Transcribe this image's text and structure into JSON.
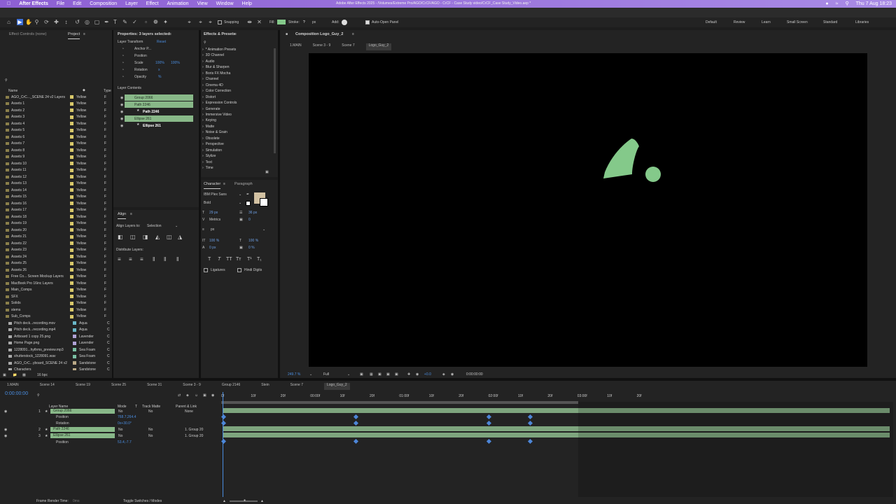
{
  "menubar": {
    "app": "After Effects",
    "items": [
      "File",
      "Edit",
      "Composition",
      "Layer",
      "Effect",
      "Animation",
      "View",
      "Window",
      "Help"
    ],
    "title": "Adobe After Effects 2025 - /Volumes/Extreme Pro/AGO/CrCF/AGO - CrCF - Case Study video/CrCF_Case Study_Video.aep *",
    "clock": "Thu 7 Aug 18:23"
  },
  "toolbar": {
    "snapping": "Snapping",
    "fill": "Fill:",
    "stroke": "Stroke:",
    "stroke_unit": "px",
    "add": "Add:",
    "auto_open": "Auto-Open Panel",
    "workspaces": [
      "Default",
      "Review",
      "Learn",
      "Small Screen",
      "Standard",
      "Libraries"
    ]
  },
  "project": {
    "tabs": [
      "Effect Controls (none)",
      "Project"
    ],
    "col_name": "Name",
    "col_type": "Type",
    "bpc": "16 bpc",
    "items": [
      {
        "name": "AGO_CrC..._SCENE 24 v2 Layers",
        "label": "Yellow",
        "kind": "F"
      },
      {
        "name": "Assets 1",
        "label": "Yellow",
        "kind": "F"
      },
      {
        "name": "Assets 2",
        "label": "Yellow",
        "kind": "F"
      },
      {
        "name": "Assets 3",
        "label": "Yellow",
        "kind": "F"
      },
      {
        "name": "Assets 4",
        "label": "Yellow",
        "kind": "F"
      },
      {
        "name": "Assets 5",
        "label": "Yellow",
        "kind": "F"
      },
      {
        "name": "Assets 6",
        "label": "Yellow",
        "kind": "F"
      },
      {
        "name": "Assets 7",
        "label": "Yellow",
        "kind": "F"
      },
      {
        "name": "Assets 8",
        "label": "Yellow",
        "kind": "F"
      },
      {
        "name": "Assets 9",
        "label": "Yellow",
        "kind": "F"
      },
      {
        "name": "Assets 10",
        "label": "Yellow",
        "kind": "F"
      },
      {
        "name": "Assets 11",
        "label": "Yellow",
        "kind": "F"
      },
      {
        "name": "Assets 12",
        "label": "Yellow",
        "kind": "F"
      },
      {
        "name": "Assets 13",
        "label": "Yellow",
        "kind": "F"
      },
      {
        "name": "Assets 14",
        "label": "Yellow",
        "kind": "F"
      },
      {
        "name": "Assets 15",
        "label": "Yellow",
        "kind": "F"
      },
      {
        "name": "Assets 16",
        "label": "Yellow",
        "kind": "F"
      },
      {
        "name": "Assets 17",
        "label": "Yellow",
        "kind": "F"
      },
      {
        "name": "Assets 18",
        "label": "Yellow",
        "kind": "F"
      },
      {
        "name": "Assets 19",
        "label": "Yellow",
        "kind": "F"
      },
      {
        "name": "Assets 20",
        "label": "Yellow",
        "kind": "F"
      },
      {
        "name": "Assets 21",
        "label": "Yellow",
        "kind": "F"
      },
      {
        "name": "Assets 22",
        "label": "Yellow",
        "kind": "F"
      },
      {
        "name": "Assets 23",
        "label": "Yellow",
        "kind": "F"
      },
      {
        "name": "Assets 24",
        "label": "Yellow",
        "kind": "F"
      },
      {
        "name": "Assets 25",
        "label": "Yellow",
        "kind": "F"
      },
      {
        "name": "Assets 26",
        "label": "Yellow",
        "kind": "F"
      },
      {
        "name": "Free Co... Screen Mockup Layers",
        "label": "Yellow",
        "kind": "F"
      },
      {
        "name": "MacBook Pro 16inc Layers",
        "label": "Yellow",
        "kind": "F"
      },
      {
        "name": "Main_Comps",
        "label": "Yellow",
        "kind": "F"
      },
      {
        "name": "SFX",
        "label": "Yellow",
        "kind": "F"
      },
      {
        "name": "Solids",
        "label": "Yellow",
        "kind": "F"
      },
      {
        "name": "stems",
        "label": "Yellow",
        "kind": "F"
      },
      {
        "name": "Sub_Comps",
        "label": "Yellow",
        "kind": "F"
      },
      {
        "name": "Pitch deck...recording.mov",
        "label": "Aqua",
        "kind": "C"
      },
      {
        "name": "Pitch deck...recording.mp4",
        "label": "Aqua",
        "kind": "C"
      },
      {
        "name": "Artboard 1 copy 25.png",
        "label": "Lavender",
        "kind": "C"
      },
      {
        "name": "Home Page.png",
        "label": "Lavender",
        "kind": "C"
      },
      {
        "name": "1228091...hythms_preview.mp3",
        "label": "Sea Foam",
        "kind": "C"
      },
      {
        "name": "shutterstock_1228091.wav",
        "label": "Sea Foam",
        "kind": "C"
      },
      {
        "name": "AGO_CrC...yboard_SCENE 24 v2",
        "label": "Sandstone",
        "kind": "C"
      },
      {
        "name": "Characters",
        "label": "Sandstone",
        "kind": "C"
      }
    ]
  },
  "properties": {
    "title": "Properties: 3 layers selected",
    "transform_title": "Layer Transform",
    "reset": "Reset",
    "fields": [
      "Anchor P...",
      "Position",
      "Scale",
      "Rotation",
      "Opacity"
    ],
    "scale_x": "100%",
    "scale_y": "100%",
    "rotation": "x",
    "opacity": "%",
    "contents_title": "Layer Contents",
    "contents": [
      "Group 2066",
      "Path 2246",
      "Path 2246",
      "Ellipse 261",
      "Ellipse 261"
    ]
  },
  "align": {
    "title": "Align",
    "align_to_label": "Align Layers to:",
    "align_to_value": "Selection",
    "distribute_label": "Distribute Layers:"
  },
  "effects": {
    "title": "Effects & Presets",
    "items": [
      "* Animation Presets",
      "3D Channel",
      "Audio",
      "Blur & Sharpen",
      "Boris FX Mocha",
      "Channel",
      "Cinema 4D",
      "Color Correction",
      "Distort",
      "Expression Controls",
      "Generate",
      "Immersive Video",
      "Keying",
      "Matte",
      "Noise & Grain",
      "Obsolete",
      "Perspective",
      "Simulation",
      "Stylize",
      "Text",
      "Time"
    ]
  },
  "character": {
    "tabs": [
      "Character",
      "Paragraph"
    ],
    "font": "IBM Plex Sans",
    "style": "Bold",
    "size": "29 px",
    "leading": "36 px",
    "kerning": "Metrics",
    "tracking": "0",
    "stroke_width": "px",
    "vscale": "100 %",
    "hscale": "100 %",
    "baseline": "0 px",
    "tsume": "0 %",
    "ligatures": "Ligatures",
    "hindi": "Hindi Digits"
  },
  "composition": {
    "title": "Composition Logo_Guy_2",
    "breadcrumbs": [
      "1.MAIN",
      "Scene 3 - 9",
      "Scene 7",
      "Logo_Guy_2"
    ],
    "zoom": "249.7 %",
    "resolution": "Full",
    "exposure": "+0.0",
    "timecode": "0:00:00:00",
    "shape_color": "#84c98a"
  },
  "timeline": {
    "tabs": [
      "1.MAIN",
      "Scene 14",
      "Scene 19",
      "Scene 25",
      "Scene 31",
      "Scene 3 - 9",
      "Group 2146",
      "Stein",
      "Scene 7",
      "Logo_Guy_2"
    ],
    "timecode": "0:00:00:00",
    "col_layer": "Layer Name",
    "col_mode": "Mode",
    "col_t": "T",
    "col_track": "Track Matte",
    "col_parent": "Parent & Link",
    "layers": [
      {
        "num": "1",
        "name": "Group 2066",
        "mode": "No",
        "parent": "None"
      },
      {
        "num": "2",
        "name": "Path 2246",
        "mode": "No",
        "parent": "1. Group 20"
      },
      {
        "num": "3",
        "name": "Ellipse 261",
        "mode": "No",
        "parent": "1. Group 20"
      }
    ],
    "props": [
      {
        "name": "Position",
        "value": "768.7,264.4"
      },
      {
        "name": "Rotation",
        "value": "0x+30.0°"
      },
      {
        "name": "Position",
        "value": "53.4,-7.7"
      }
    ],
    "ruler": [
      "0f",
      "10f",
      "20f",
      "00:00f",
      "10f",
      "20f",
      "01:00f",
      "10f",
      "20f",
      "02:00f",
      "10f",
      "20f",
      "03:00f",
      "10f",
      "20f"
    ],
    "render_time_label": "Frame Render Time:",
    "render_time": "0ms",
    "toggle": "Toggle Switches / Modes"
  }
}
